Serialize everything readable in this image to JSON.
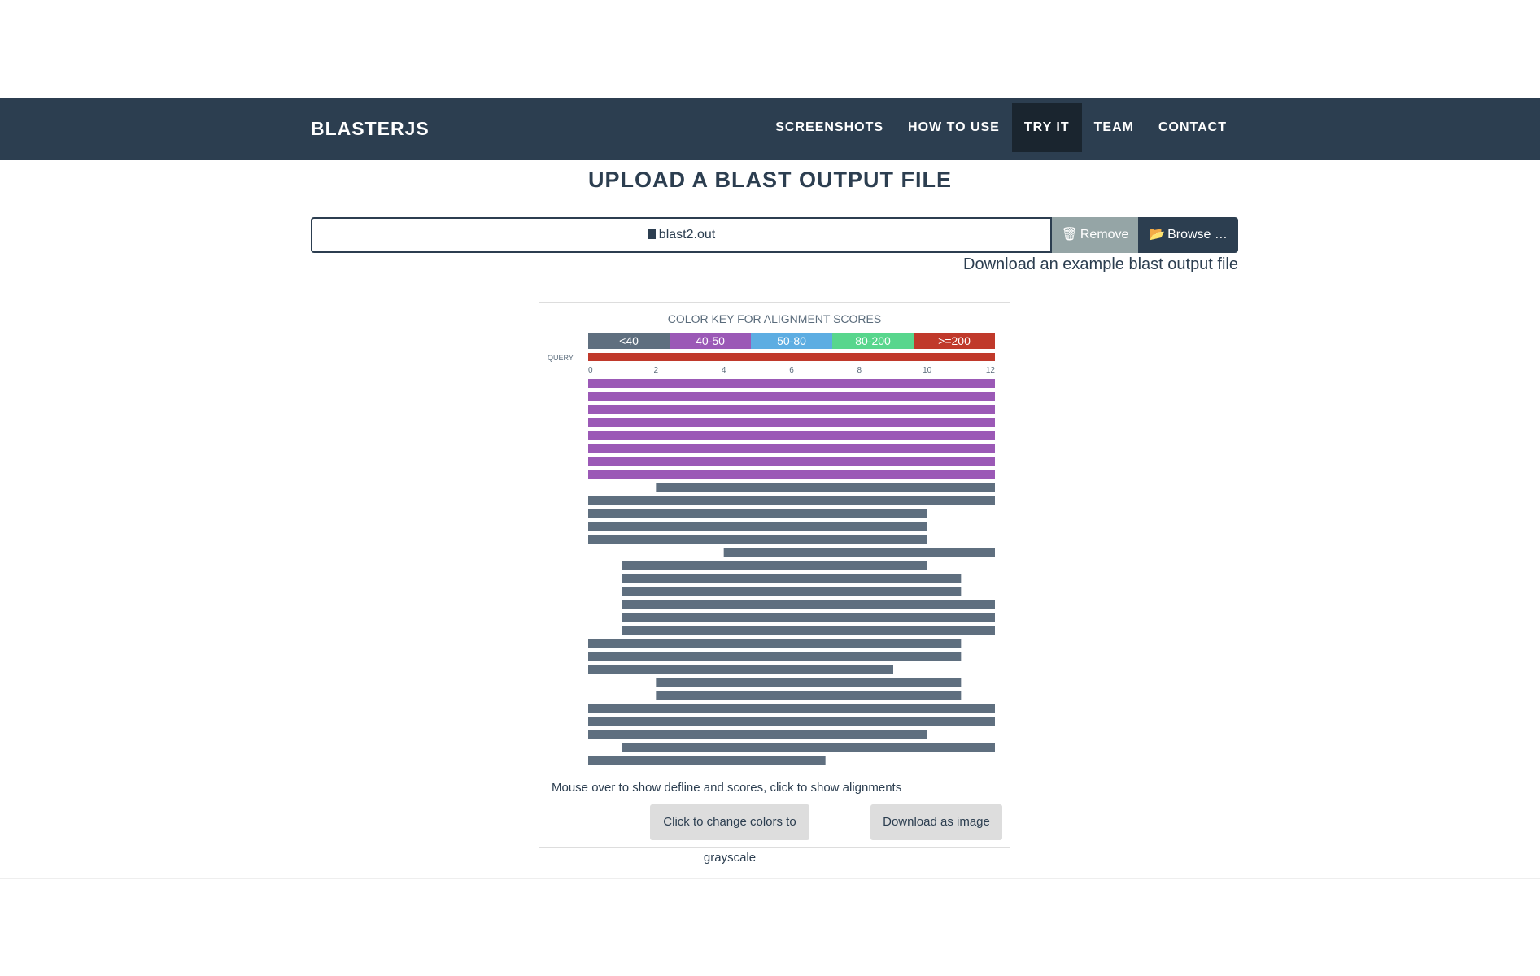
{
  "navbar": {
    "brand": "BLASTERJS",
    "links": [
      "SCREENSHOTS",
      "HOW TO USE",
      "TRY IT",
      "TEAM",
      "CONTACT"
    ],
    "active_link": "TRY IT"
  },
  "page": {
    "title": "UPLOAD A BLAST OUTPUT FILE",
    "file_name": "blast2.out",
    "remove_label": "Remove",
    "browse_label": "Browse …",
    "download_example_label": "Download an example blast output file"
  },
  "colors": {
    "navbar": "#2c3e50",
    "active_nav": "#1a252f",
    "remove_button": "#95a5a6",
    "browse_button": "#2c3e50"
  },
  "chart_data": {
    "type": "alignment",
    "title": "COLOR KEY FOR ALIGNMENT SCORES",
    "query_label": "QUERY",
    "score_key": [
      {
        "label": "<40",
        "color": "#5f6f7f"
      },
      {
        "label": "40-50",
        "color": "#9b59b6"
      },
      {
        "label": "50-80",
        "color": "#5dade2"
      },
      {
        "label": "80-200",
        "color": "#58d68d"
      },
      {
        "label": ">=200",
        "color": "#c0392b"
      }
    ],
    "query_length": 12,
    "x_ticks": [
      0,
      2,
      4,
      6,
      8,
      10,
      12
    ],
    "hits": [
      {
        "start": 0,
        "end": 12,
        "score": "40-50"
      },
      {
        "start": 0,
        "end": 12,
        "score": "40-50"
      },
      {
        "start": 0,
        "end": 12,
        "score": "40-50"
      },
      {
        "start": 0,
        "end": 12,
        "score": "40-50"
      },
      {
        "start": 0,
        "end": 12,
        "score": "40-50"
      },
      {
        "start": 0,
        "end": 12,
        "score": "40-50"
      },
      {
        "start": 0,
        "end": 12,
        "score": "40-50"
      },
      {
        "start": 0,
        "end": 12,
        "score": "40-50"
      },
      {
        "start": 2,
        "end": 12,
        "score": "<40"
      },
      {
        "start": 0,
        "end": 12,
        "score": "<40"
      },
      {
        "start": 0,
        "end": 10,
        "score": "<40"
      },
      {
        "start": 0,
        "end": 10,
        "score": "<40"
      },
      {
        "start": 0,
        "end": 10,
        "score": "<40"
      },
      {
        "start": 4,
        "end": 12,
        "score": "<40"
      },
      {
        "start": 1,
        "end": 10,
        "score": "<40"
      },
      {
        "start": 1,
        "end": 11,
        "score": "<40"
      },
      {
        "start": 1,
        "end": 11,
        "score": "<40"
      },
      {
        "start": 1,
        "end": 12,
        "score": "<40"
      },
      {
        "start": 1,
        "end": 12,
        "score": "<40"
      },
      {
        "start": 1,
        "end": 12,
        "score": "<40"
      },
      {
        "start": 0,
        "end": 11,
        "score": "<40"
      },
      {
        "start": 0,
        "end": 11,
        "score": "<40"
      },
      {
        "start": 0,
        "end": 9,
        "score": "<40"
      },
      {
        "start": 2,
        "end": 11,
        "score": "<40"
      },
      {
        "start": 2,
        "end": 11,
        "score": "<40"
      },
      {
        "start": 0,
        "end": 12,
        "score": "<40"
      },
      {
        "start": 0,
        "end": 12,
        "score": "<40"
      },
      {
        "start": 0,
        "end": 10,
        "score": "<40"
      },
      {
        "start": 1,
        "end": 12,
        "score": "<40"
      },
      {
        "start": 0,
        "end": 7,
        "score": "<40"
      }
    ]
  },
  "panel": {
    "mouse_text": "Mouse over to show defline and scores, click to show alignments",
    "grayscale_label": "Click to change colors to grayscale",
    "download_image_label": "Download as image"
  }
}
